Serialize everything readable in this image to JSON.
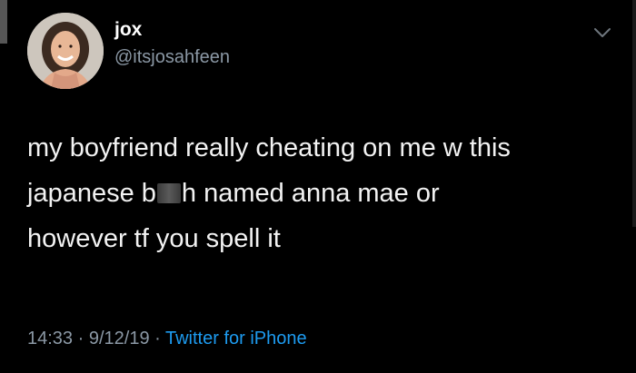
{
  "user": {
    "display_name": "jox",
    "handle": "@itsjosahfeen"
  },
  "tweet": {
    "line1": "my boyfriend really cheating on me w this",
    "line2_before": "japanese b",
    "line2_after": "h named anna mae or",
    "line3": "however tf you spell it"
  },
  "meta": {
    "time": "14:33",
    "sep1": " · ",
    "date": "9/12/19",
    "sep2": " · ",
    "source": "Twitter for iPhone"
  },
  "icons": {
    "avatar": "avatar",
    "menu": "chevron-down-icon"
  },
  "colors": {
    "background": "#000000",
    "text": "#ffffff",
    "secondary": "#8b98a5",
    "link": "#1d9bf0"
  }
}
